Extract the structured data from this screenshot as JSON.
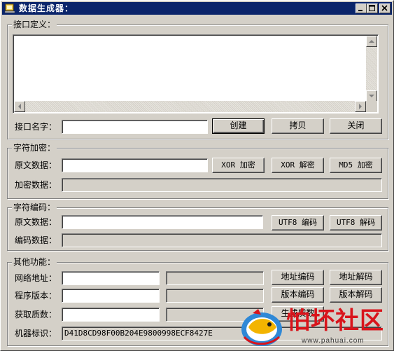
{
  "window": {
    "title": "数据生成器：",
    "icon": "app-icon",
    "controls": [
      "minimize-icon",
      "maximize-icon",
      "close-icon"
    ]
  },
  "interface_group": {
    "title": "接口定义：",
    "memo_text": "",
    "name_label": "接口名字：",
    "name_value": "",
    "create_button": "创建",
    "copy_button": "拷贝",
    "close_button": "关闭"
  },
  "encrypt_group": {
    "title": "字符加密：",
    "source_label": "原文数据：",
    "source_value": "",
    "xor_encrypt_button": "XOR 加密",
    "xor_decrypt_button": "XOR 解密",
    "md5_encrypt_button": "MD5 加密",
    "result_label": "加密数据：",
    "result_value": ""
  },
  "encode_group": {
    "title": "字符编码：",
    "source_label": "原文数据：",
    "source_value": "",
    "utf8_encode_button": "UTF8 编码",
    "utf8_decode_button": "UTF8 解码",
    "result_label": "编码数据：",
    "result_value": ""
  },
  "other_group": {
    "title": "其他功能：",
    "address_label": "网络地址：",
    "address_value": "",
    "address_result": "",
    "address_encode_button": "地址编码",
    "address_decode_button": "地址解码",
    "version_label": "程序版本：",
    "version_value": "",
    "version_result": "",
    "version_encode_button": "版本编码",
    "version_decode_button": "版本解码",
    "prime_label": "获取质数：",
    "prime_value": "",
    "prime_result": "",
    "prime_button": "生成质数",
    "machine_label": "机器标识：",
    "machine_value": "D41D8CD98F00B204E9800998ECF8427E"
  },
  "watermark": {
    "title": "怕坏社区",
    "url": "www.pahuai.com"
  }
}
